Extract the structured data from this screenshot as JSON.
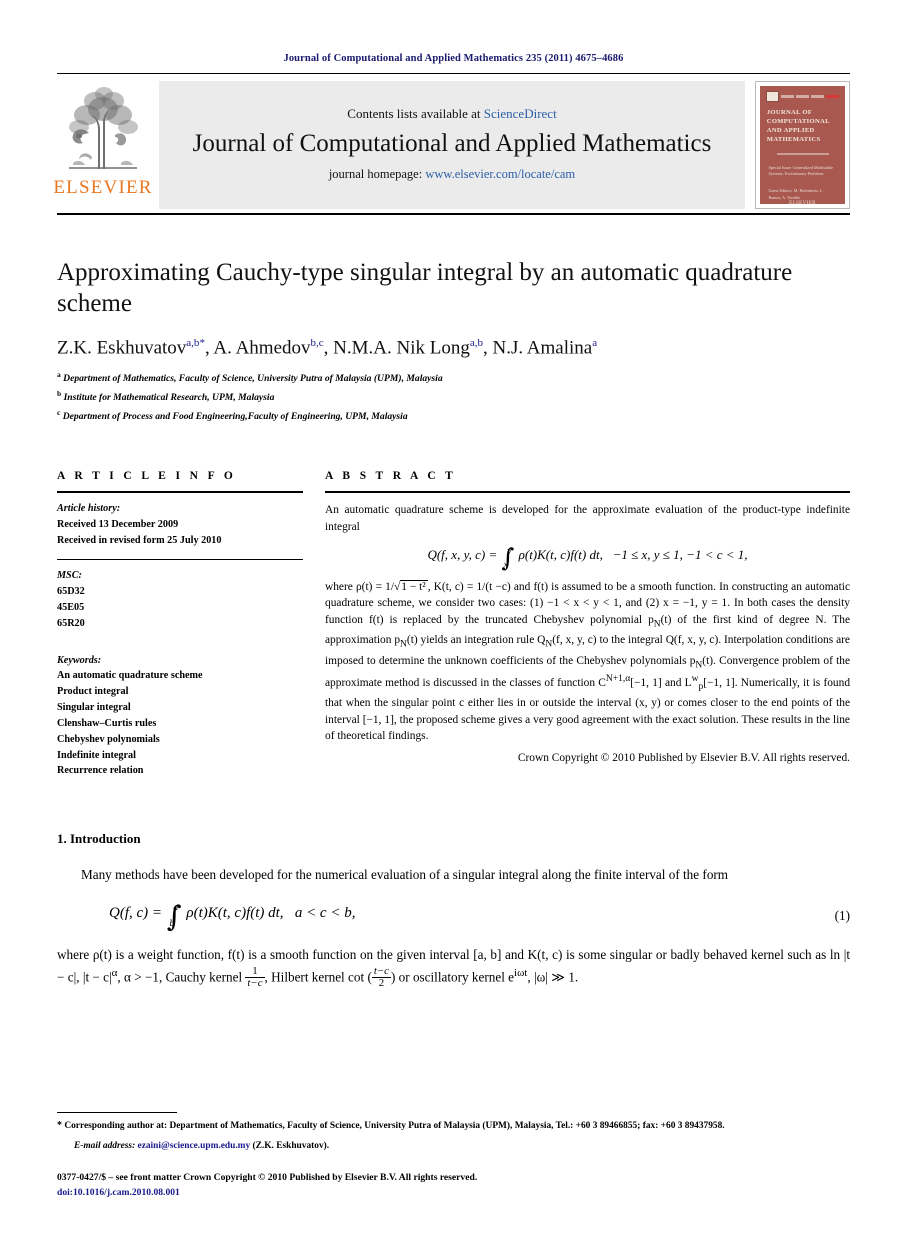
{
  "running_head": "Journal of Computational and Applied Mathematics 235 (2011) 4675–4686",
  "masthead": {
    "publisher_name": "ELSEVIER",
    "contents_prefix": "Contents lists available at",
    "contents_link": "ScienceDirect",
    "journal_title": "Journal of Computational and Applied Mathematics",
    "homepage_label": "journal homepage:",
    "homepage_url": "www.elsevier.com/locate/cam",
    "cover_title": "JOURNAL OF COMPUTATIONAL AND APPLIED MATHEMATICS",
    "cover_subtitle": "Special Issue: Generalized Multistable Systems: Evolutionary Problems",
    "cover_editors": "Guest Editors: M. Hafenstein, L. Ramos, A. Terrible",
    "cover_publisher": "ELSEVIER"
  },
  "article": {
    "title": "Approximating Cauchy-type singular integral by an automatic quadrature scheme",
    "authors": [
      {
        "name": "Z.K. Eskhuvatov",
        "marks": "a,b",
        "corresponding": true
      },
      {
        "name": "A. Ahmedov",
        "marks": "b,c",
        "corresponding": false
      },
      {
        "name": "N.M.A. Nik Long",
        "marks": "a,b",
        "corresponding": false
      },
      {
        "name": "N.J. Amalina",
        "marks": "a",
        "corresponding": false
      }
    ],
    "affiliations": [
      {
        "mark": "a",
        "text": "Department of Mathematics, Faculty of Science, University Putra of Malaysia (UPM), Malaysia"
      },
      {
        "mark": "b",
        "text": "Institute for Mathematical Research, UPM, Malaysia"
      },
      {
        "mark": "c",
        "text": "Department of Process and Food Engineering,Faculty of Engineering, UPM, Malaysia"
      }
    ]
  },
  "article_info": {
    "heading": "A R T I C L E   I N F O",
    "history_label": "Article history:",
    "history": [
      "Received 13 December 2009",
      "Received in revised form 25 July 2010"
    ],
    "msc_label": "MSC:",
    "msc": [
      "65D32",
      "45E05",
      "65R20"
    ],
    "keywords_label": "Keywords:",
    "keywords": [
      "An automatic quadrature scheme",
      "Product integral",
      "Singular integral",
      "Clenshaw–Curtis rules",
      "Chebyshev polynomials",
      "Indefinite integral",
      "Recurrence relation"
    ]
  },
  "abstract": {
    "heading": "A B S T R A C T",
    "intro": "An automatic quadrature scheme is developed for the approximate evaluation of the product-type indefinite integral",
    "equation_lhs": "Q(f, x, y, c) =",
    "equation_upper": "y",
    "equation_lower": "x",
    "equation_body": "ρ(t)K(t, c)f(t) dt,",
    "equation_conditions": "−1 ≤ x, y ≤ 1, −1 < c < 1,",
    "body_part1": "where ρ(t) = 1/",
    "body_sqrt": "1 − t²",
    "body_part2": ", K(t, c) = 1/(t −c) and f(t) is assumed to be a smooth function. In constructing an automatic quadrature scheme, we consider two cases: (1) −1 < x < y < 1, and (2) x = −1, y = 1. In both cases the density function f(t) is replaced by the truncated Chebyshev polynomial p",
    "body_part3": "(t) of the first kind of degree N. The approximation p",
    "body_part4": "(t) yields an integration rule Q",
    "body_part5": "(f, x, y, c) to the integral Q(f, x, y, c). Interpolation conditions are imposed to determine the unknown coefficients of the Chebyshev polynomials p",
    "body_part6": "(t). Convergence problem of the approximate method is discussed in the classes of function C",
    "class1_sup": "N+1,α",
    "body_part7": "[−1, 1] and L",
    "class2_sup": "w",
    "class2_sub": "p",
    "body_part8": "[−1, 1]. Numerically, it is found that when the singular point c either lies in or outside the interval (x, y) or comes closer to the end points of the interval [−1, 1], the proposed scheme gives a very good agreement with the exact solution. These results in the line of theoretical findings.",
    "copyright": "Crown Copyright © 2010 Published by Elsevier B.V. All rights reserved."
  },
  "section": {
    "heading": "1. Introduction",
    "paragraph1": "Many methods have been developed for the numerical evaluation of a singular integral along the finite interval of the form",
    "equation1": {
      "lhs": "Q(f, c) =",
      "upper": "a",
      "lower": "b",
      "body": "ρ(t)K(t, c)f(t) dt,",
      "conditions": "a < c < b,",
      "number": "(1)"
    },
    "paragraph2_a": "where ρ(t) is a weight function, f(t) is a smooth function on the given interval [a, b] and K(t, c) is some singular or badly behaved kernel such as ln |t − c|, |t − c|",
    "paragraph2_alpha": "α",
    "paragraph2_b": ", α > −1, Cauchy kernel",
    "frac1_num": "1",
    "frac1_den": "t−c",
    "paragraph2_c": ", Hilbert kernel cot",
    "frac2_num": "t−c",
    "frac2_den": "2",
    "paragraph2_d": "or oscillatory kernel e",
    "paragraph2_exp": "iωt",
    "paragraph2_e": ", |ω| ≫ 1."
  },
  "footnotes": {
    "corresponding_mark": "*",
    "corresponding_text": "Corresponding author at: Department of Mathematics, Faculty of Science, University Putra of Malaysia (UPM), Malaysia, Tel.: +60 3 89466855; fax: +60 3 89437958.",
    "email_label": "E-mail address:",
    "email": "ezaini@science.upm.edu.my",
    "email_owner": "(Z.K. Eskhuvatov).",
    "imprint": "0377-0427/$ – see front matter Crown Copyright © 2010 Published by Elsevier B.V. All rights reserved.",
    "doi": "doi:10.1016/j.cam.2010.08.001"
  },
  "colors": {
    "link": "#1a1a8c",
    "sciencedirect": "#2b5ea8",
    "elsevier_orange": "#E87722",
    "cover": "#a8584e",
    "runhead": "#1a1a6e"
  }
}
